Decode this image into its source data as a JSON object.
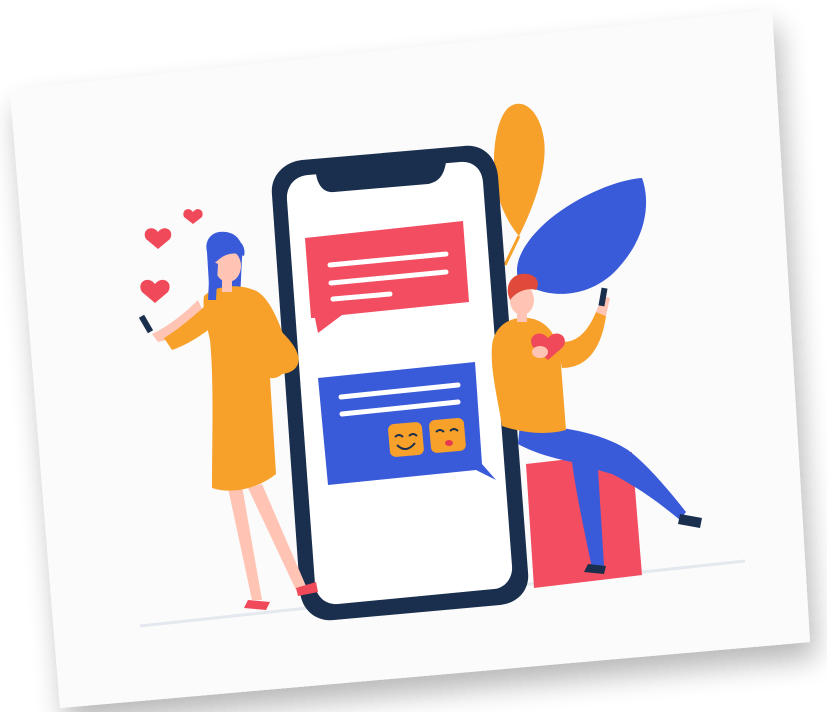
{
  "illustration": {
    "subject": "online-dating-chat",
    "colors": {
      "background": "#ffffff",
      "card": "#fbfbfb",
      "phone_frame": "#1a2f4d",
      "phone_screen": "#ffffff",
      "bubble_red": "#f24d61",
      "bubble_blue": "#3a5bd9",
      "accent_orange": "#f7a02a",
      "heart_red": "#f04a5a",
      "skin": "#ffc4b4",
      "woman_hair": "#3a5bd9",
      "man_hair": "#e04a3a",
      "man_pants": "#3a5bd9",
      "seat_red": "#f24d61",
      "leaf_blue": "#3a5bd9",
      "leaf_orange": "#f7a02a",
      "ground_line": "#e4e8ef",
      "text_lines": "#ffffff"
    },
    "icons": [
      "heart-icon",
      "smiling-emoji-icon",
      "kissing-emoji-icon",
      "message-bubble-icon"
    ]
  }
}
